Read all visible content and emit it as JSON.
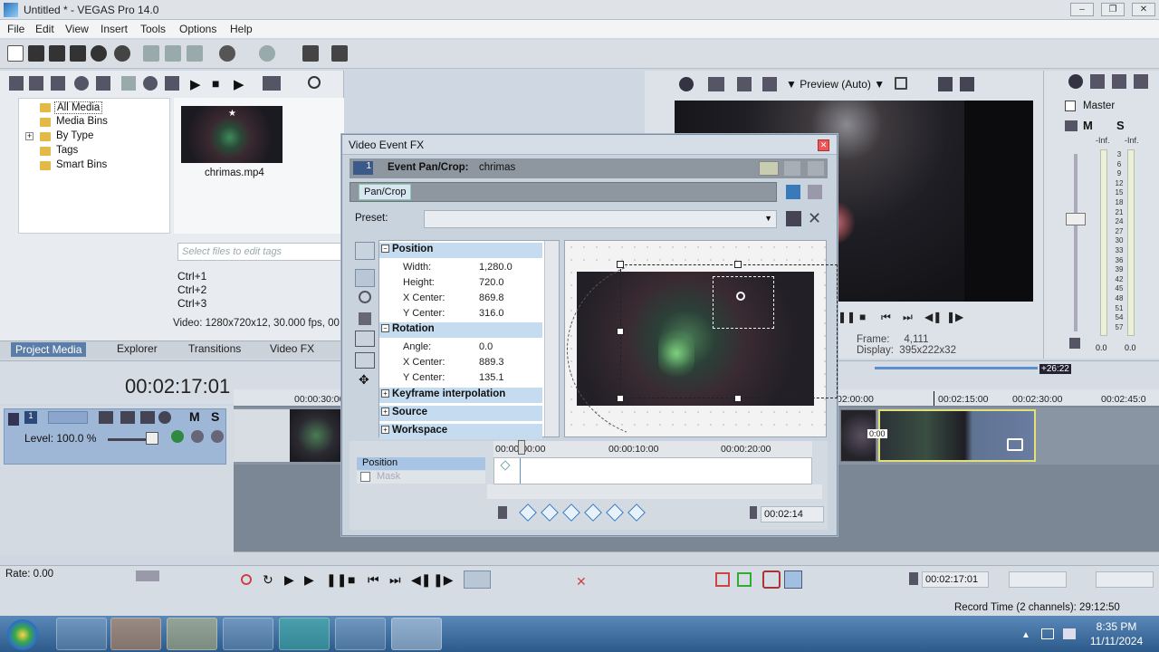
{
  "window": {
    "title": "Untitled * - VEGAS Pro 14.0",
    "controls": [
      "–",
      "❐",
      "✕"
    ]
  },
  "menu": [
    "File",
    "Edit",
    "View",
    "Insert",
    "Tools",
    "Options",
    "Help"
  ],
  "project_media": {
    "tree": [
      "All Media",
      "Media Bins",
      "By Type",
      "Tags",
      "Smart Bins"
    ],
    "thumbnail_label": "chrimas.mp4",
    "tags_placeholder": "Select files to edit tags",
    "shortcuts": [
      "Ctrl+1",
      "Ctrl+2",
      "Ctrl+3"
    ],
    "video_info": "Video: 1280x720x12, 30.000 fps, 00:",
    "tabs": [
      "Project Media",
      "Explorer",
      "Transitions",
      "Video FX"
    ]
  },
  "preview": {
    "quality": "Preview (Auto)",
    "frame_label": "Frame:",
    "frame": "4,111",
    "display_label": "Display:",
    "display": "395x222x32"
  },
  "mixer": {
    "title": "Master",
    "m": "M",
    "s": "S",
    "inf_left": "-Inf.",
    "inf_right": "-Inf.",
    "scale": [
      "3",
      "6",
      "9",
      "12",
      "15",
      "18",
      "21",
      "24",
      "27",
      "30",
      "33",
      "36",
      "39",
      "42",
      "45",
      "48",
      "51",
      "54",
      "57"
    ],
    "out_left": "0.0",
    "out_right": "0.0"
  },
  "timeline": {
    "timecode": "00:02:17:01",
    "ruler": [
      "00:00:30:00",
      "02:00:00",
      "00:02:15:00",
      "00:02:30:00",
      "00:02:45:0"
    ],
    "end_marker": "+26:22",
    "track": {
      "number": "1",
      "level": "Level: 100.0 %",
      "m": "M",
      "s": "S"
    },
    "clip_badge": "0:00"
  },
  "bottom": {
    "rate": "Rate: 0.00",
    "time": "00:02:17:01",
    "record_time": "Record Time (2 channels): 29:12:50"
  },
  "taskbar": {
    "time": "8:35 PM",
    "date": "11/11/2024"
  },
  "fx_dialog": {
    "title": "Video Event FX",
    "close": "✕",
    "track_number": "1",
    "header_label": "Event Pan/Crop:",
    "header_value": "chrimas",
    "chain_button": "Pan/Crop",
    "preset_label": "Preset:",
    "sections": {
      "position": "Position",
      "rotation": "Rotation",
      "keyframe": "Keyframe interpolation",
      "source": "Source",
      "workspace": "Workspace"
    },
    "position_props": [
      {
        "label": "Width:",
        "value": "1,280.0"
      },
      {
        "label": "Height:",
        "value": "720.0"
      },
      {
        "label": "X Center:",
        "value": "869.8"
      },
      {
        "label": "Y Center:",
        "value": "316.0"
      }
    ],
    "rotation_props": [
      {
        "label": "Angle:",
        "value": "0.0"
      },
      {
        "label": "X Center:",
        "value": "889.3"
      },
      {
        "label": "Y Center:",
        "value": "135.1"
      }
    ],
    "kf_ruler": [
      "00:00:00:00",
      "00:00:10:00",
      "00:00:20:00"
    ],
    "kf_tracks": [
      "Position",
      "Mask"
    ],
    "kf_time": "00:02:14"
  },
  "colors": {
    "accent": "#5b7ea8",
    "selection": "#c5dcf0",
    "clip_border": "#e3e07a"
  }
}
